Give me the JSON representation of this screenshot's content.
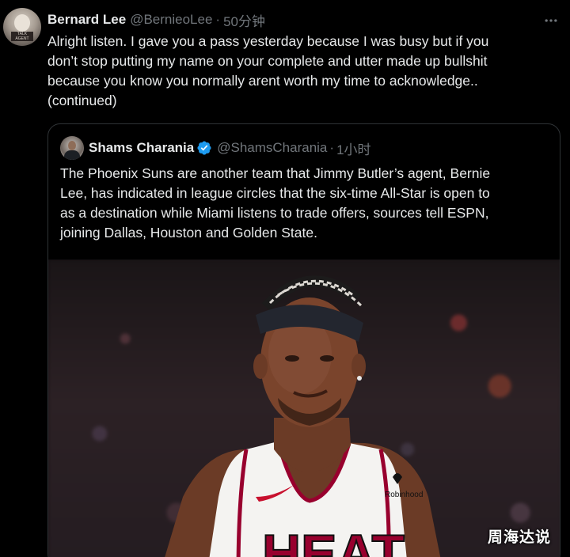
{
  "tweet": {
    "author": {
      "display_name": "Bernard Lee",
      "handle": "@BernieoLee",
      "time": "50分钟",
      "avatar_text": "TALK AGENT"
    },
    "separator": "·",
    "body_lines": [
      "Alright listen.  I gave you a pass yesterday because I was busy but if you",
      "don’t stop putting my name on your complete and utter made up bullshit",
      "because you know you normally arent worth my time to acknowledge..",
      "(continued)"
    ],
    "more_icon": "more-horizontal-icon"
  },
  "quoted_tweet": {
    "author": {
      "display_name": "Shams Charania",
      "handle": "@ShamsCharania",
      "time": "1小时",
      "verified": true
    },
    "separator": "·",
    "body_lines": [
      "The Phoenix Suns are another team that Jimmy Butler’s agent, Bernie",
      "Lee, has indicated in league circles that the six-time All-Star is open to",
      "as a destination while Miami listens to trade offers, sources tell ESPN,",
      "joining Dallas, Houston and Golden State."
    ],
    "media": {
      "jersey_text": "HEAT",
      "sponsor_text": "Robinhood"
    }
  },
  "watermark": "周海达说",
  "colors": {
    "background": "#000000",
    "text_primary": "#e7e9ea",
    "text_secondary": "#71767b",
    "border": "#2f3336",
    "verified_blue": "#1d9bf0",
    "heat_red": "#98002e"
  }
}
